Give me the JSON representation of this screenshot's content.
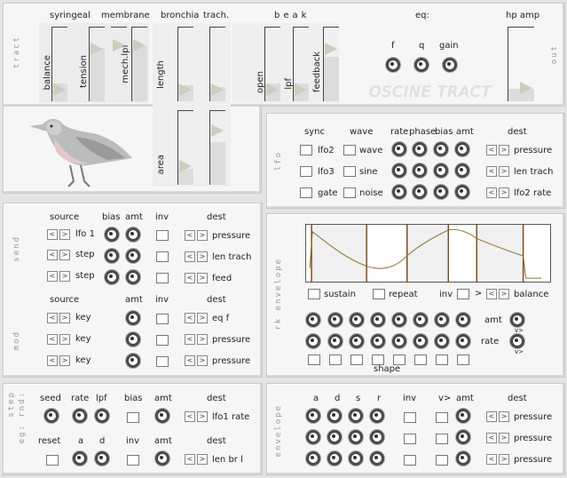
{
  "tract": {
    "panel_label": "tract",
    "headers": {
      "syringeal": "syringeal",
      "membrane": "membrane",
      "bronchia": "bronchia",
      "trach": "trach.",
      "beak": "beak",
      "eq": "eq:",
      "hp_amp": "hp amp"
    },
    "sliders": {
      "balance": "balance",
      "tension": "tension",
      "mech_lpf": "mech.lpf",
      "length": "length",
      "area": "area",
      "open": "open",
      "lpf": "lpf",
      "feedback": "feedback"
    },
    "eq_knobs": {
      "f": "f",
      "q": "q",
      "gain": "gain"
    },
    "out_label": "out",
    "logo": "OSCINE TRACT"
  },
  "lfo": {
    "panel_label": "lfo",
    "headers": {
      "sync": "sync",
      "wave": "wave",
      "rate": "rate",
      "phase": "phase",
      "bias": "bias",
      "amt": "amt",
      "dest": "dest"
    },
    "rows": [
      {
        "sync": "lfo2",
        "wave": "wave",
        "dest": "pressure"
      },
      {
        "sync": "lfo3",
        "wave": "sine",
        "dest": "len trach"
      },
      {
        "sync": "gate",
        "wave": "noise",
        "dest": "lfo2 rate"
      }
    ]
  },
  "send": {
    "panel_label": "send",
    "headers": {
      "source": "source",
      "bias": "bias",
      "amt": "amt",
      "inv": "inv",
      "dest": "dest"
    },
    "rows": [
      {
        "source": "lfo 1",
        "dest": "pressure"
      },
      {
        "source": "step",
        "dest": "len trach"
      },
      {
        "source": "step",
        "dest": "feed"
      }
    ]
  },
  "mod": {
    "panel_label": "mod",
    "headers": {
      "source": "source",
      "amt": "amt",
      "inv": "inv",
      "dest": "dest"
    },
    "rows": [
      {
        "source": "key",
        "dest": "eq f"
      },
      {
        "source": "key",
        "dest": "pressure"
      },
      {
        "source": "key",
        "dest": "pressure"
      }
    ]
  },
  "rk_env": {
    "panel_label": "rk envelope",
    "sustain": "sustain",
    "repeat": "repeat",
    "inv": "inv",
    "inv_arrow": ">",
    "dest": "balance",
    "amt": "amt",
    "rate": "rate",
    "shape": "shape",
    "knob_marker": "v>"
  },
  "step": {
    "panel_label": "step",
    "panel_label2": "eg: rnd:",
    "headers": {
      "seed": "seed",
      "rate": "rate",
      "lpf": "lpf",
      "bias": "bias",
      "amt": "amt",
      "dest": "dest",
      "reset": "reset",
      "a": "a",
      "d": "d",
      "inv": "inv"
    },
    "dest1": "lfo1 rate",
    "dest2": "len br l"
  },
  "envelope": {
    "panel_label": "envelope",
    "headers": {
      "a": "a",
      "d": "d",
      "s": "s",
      "r": "r",
      "inv": "inv",
      "v": "v>",
      "amt": "amt",
      "dest": "dest"
    },
    "dests": [
      "pressure",
      "pressure",
      "pressure"
    ]
  },
  "colors": {
    "slider_fill": "#dcdcdc",
    "triangle": "#c7d0bc",
    "envelope_line": "#8b6d2a",
    "envelope_marker": "#7a4a1a"
  }
}
